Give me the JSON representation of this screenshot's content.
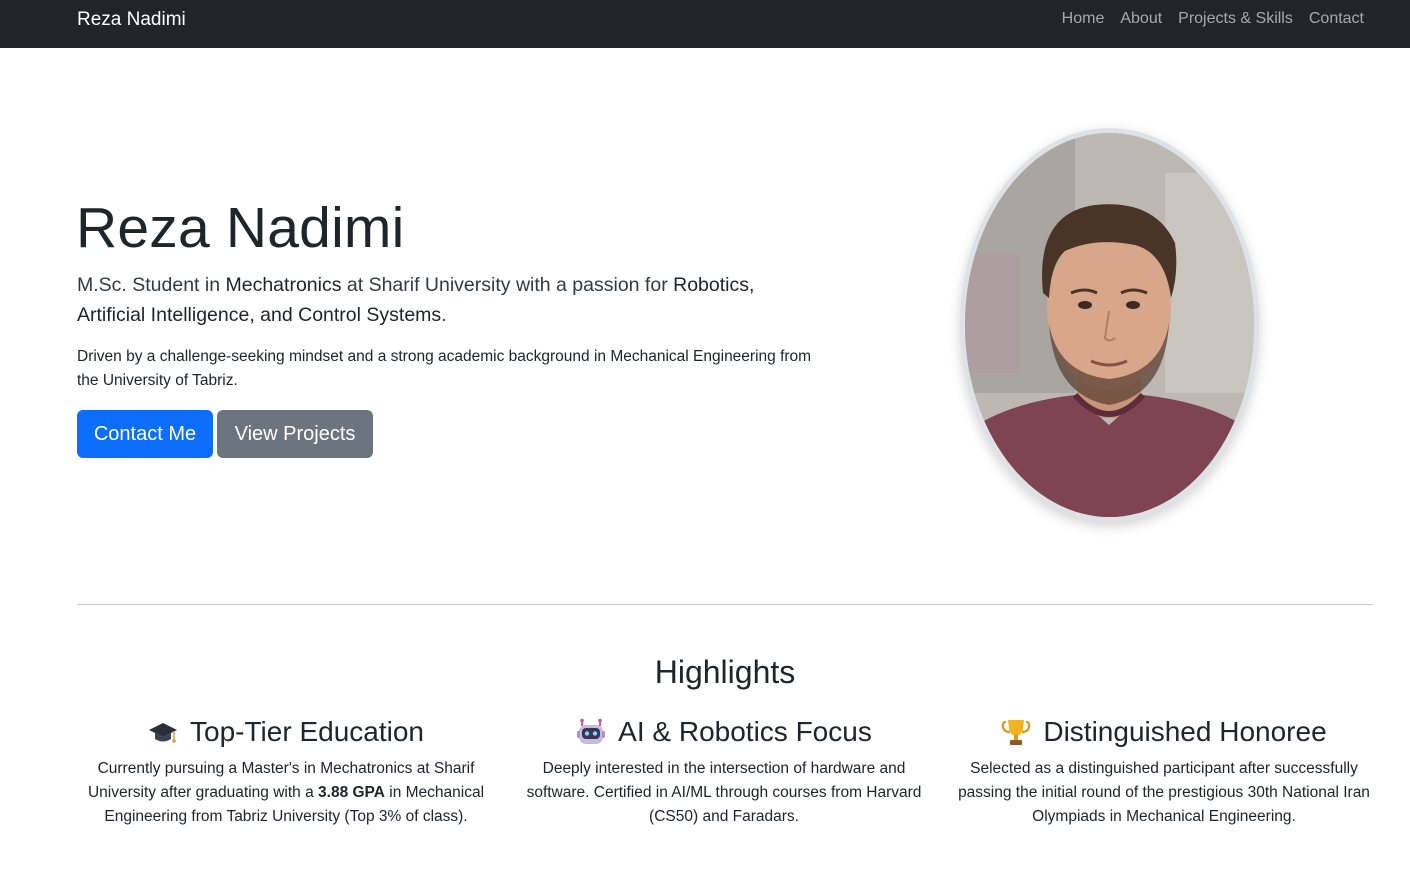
{
  "navbar": {
    "brand": "Reza Nadimi",
    "links": [
      "Home",
      "About",
      "Projects & Skills",
      "Contact"
    ]
  },
  "hero": {
    "title": "Reza Nadimi",
    "lead": {
      "p1": "M.Sc. Student in ",
      "b1": "Mechatronics",
      "p2": " at Sharif University with a passion for ",
      "b2": "Robotics, Artificial Intelligence, and Control Systems",
      "p3": "."
    },
    "description": "Driven by a challenge-seeking mindset and a strong academic background in Mechanical Engineering from the University of Tabriz.",
    "buttons": {
      "contact": "Contact Me",
      "projects": "View Projects"
    },
    "photo_alt": "profile-photo"
  },
  "highlights": {
    "title": "Highlights",
    "cards": [
      {
        "icon": "graduation-cap-icon",
        "title": "Top-Tier Education",
        "text_1": "Currently pursuing a Master's in Mechatronics at Sharif University after graduating with a ",
        "text_bold": "3.88 GPA",
        "text_2": " in Mechanical Engineering from Tabriz University (Top 3% of class)."
      },
      {
        "icon": "robot-icon",
        "title": "AI & Robotics Focus",
        "text": "Deeply interested in the intersection of hardware and software. Certified in AI/ML through courses from Harvard (CS50) and Faradars."
      },
      {
        "icon": "trophy-icon",
        "title": "Distinguished Honoree",
        "text": "Selected as a distinguished participant after successfully passing the initial round of the prestigious 30th National Iran Olympiads in Mechanical Engineering."
      }
    ]
  },
  "colors": {
    "navbar": "#212529",
    "primary": "#0d6efd",
    "secondary": "#6c757d"
  }
}
